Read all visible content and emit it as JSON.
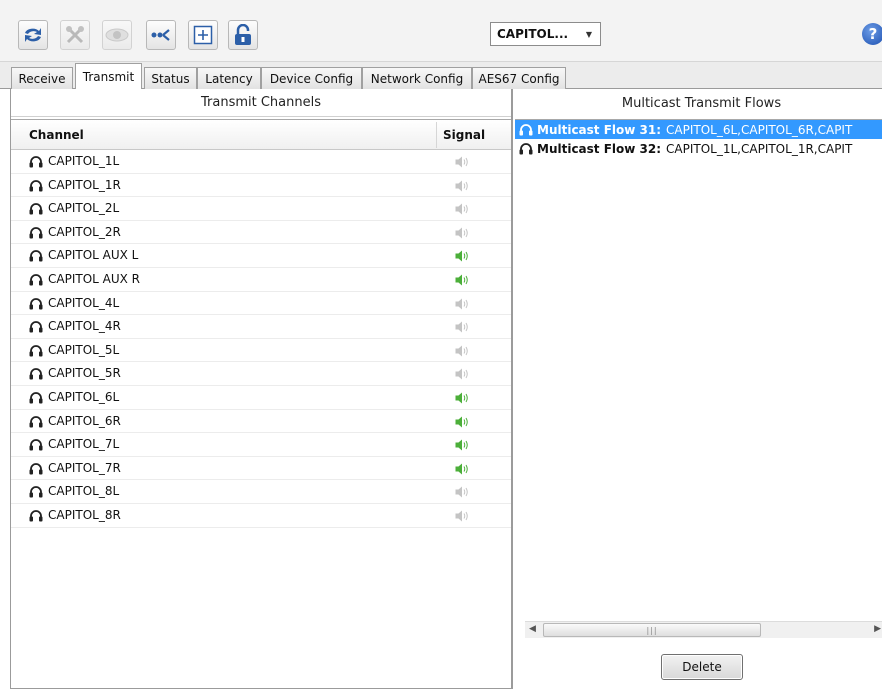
{
  "toolbar": {
    "device_select": "CAPITOL...",
    "help_label": "?",
    "buttons": [
      {
        "icon": "refresh-icon",
        "enabled": true
      },
      {
        "icon": "tools-icon",
        "enabled": false
      },
      {
        "icon": "eye-icon",
        "enabled": false
      },
      {
        "icon": "network-icon",
        "enabled": true
      },
      {
        "icon": "add-icon",
        "enabled": true
      },
      {
        "icon": "unlock-icon",
        "enabled": true
      }
    ]
  },
  "tabs": [
    {
      "label": "Receive",
      "active": false
    },
    {
      "label": "Transmit",
      "active": true
    },
    {
      "label": "Status",
      "active": false
    },
    {
      "label": "Latency",
      "active": false
    },
    {
      "label": "Device Config",
      "active": false
    },
    {
      "label": "Network Config",
      "active": false
    },
    {
      "label": "AES67 Config",
      "active": false
    }
  ],
  "transmit": {
    "title": "Transmit Channels",
    "columns": {
      "channel": "Channel",
      "signal": "Signal"
    },
    "channels": [
      {
        "name": "CAPITOL_1L",
        "signal": false
      },
      {
        "name": "CAPITOL_1R",
        "signal": false
      },
      {
        "name": "CAPITOL_2L",
        "signal": false
      },
      {
        "name": "CAPITOL_2R",
        "signal": false
      },
      {
        "name": "CAPITOL AUX L",
        "signal": true
      },
      {
        "name": "CAPITOL AUX R",
        "signal": true
      },
      {
        "name": "CAPITOL_4L",
        "signal": false
      },
      {
        "name": "CAPITOL_4R",
        "signal": false
      },
      {
        "name": "CAPITOL_5L",
        "signal": false
      },
      {
        "name": "CAPITOL_5R",
        "signal": false
      },
      {
        "name": "CAPITOL_6L",
        "signal": true
      },
      {
        "name": "CAPITOL_6R",
        "signal": true
      },
      {
        "name": "CAPITOL_7L",
        "signal": true
      },
      {
        "name": "CAPITOL_7R",
        "signal": true
      },
      {
        "name": "CAPITOL_8L",
        "signal": false
      },
      {
        "name": "CAPITOL_8R",
        "signal": false
      }
    ]
  },
  "multicast": {
    "title": "Multicast Transmit Flows",
    "flows": [
      {
        "label": "Multicast Flow 31:",
        "channels": "CAPITOL_6L,CAPITOL_6R,CAPIT",
        "selected": true
      },
      {
        "label": "Multicast Flow 32:",
        "channels": "CAPITOL_1L,CAPITOL_1R,CAPIT",
        "selected": false
      }
    ],
    "delete_label": "Delete"
  },
  "colors": {
    "selection": "#3399ff",
    "signal_on": "#4caf3a",
    "signal_off": "#c4c4c4"
  }
}
